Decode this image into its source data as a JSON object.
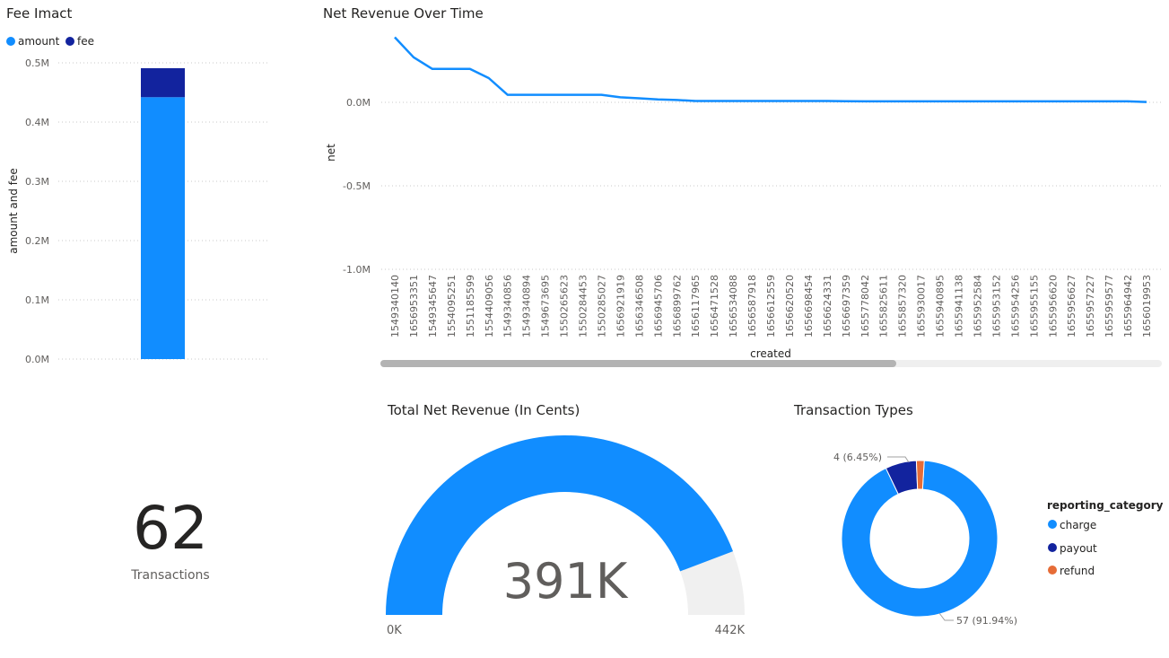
{
  "fee_chart": {
    "title": "Fee Imact",
    "legend": [
      {
        "label": "amount",
        "color": "#118DFF"
      },
      {
        "label": "fee",
        "color": "#12239E"
      }
    ],
    "ylabel": "amount and fee",
    "yticks": [
      "0.0M",
      "0.1M",
      "0.2M",
      "0.3M",
      "0.4M",
      "0.5M"
    ]
  },
  "line_chart": {
    "title": "Net Revenue Over Time",
    "ylabel": "net",
    "xlabel": "created",
    "yticks": [
      "0.0M",
      "-0.5M",
      "-1.0M"
    ]
  },
  "card": {
    "value": "62",
    "label": "Transactions"
  },
  "gauge": {
    "title": "Total Net Revenue (In Cents)",
    "value_label": "391K",
    "min_label": "0K",
    "max_label": "442K"
  },
  "donut": {
    "title": "Transaction Types",
    "legend_title": "reporting_category",
    "legend": [
      {
        "label": "charge",
        "color": "#118DFF"
      },
      {
        "label": "payout",
        "color": "#12239E"
      },
      {
        "label": "refund",
        "color": "#E66C37"
      }
    ],
    "callout_payout": "4 (6.45%)",
    "callout_charge": "57 (91.94%)"
  },
  "chart_data": [
    {
      "type": "bar",
      "title": "Fee Imact",
      "ylabel": "amount and fee",
      "ylim": [
        0,
        0.5
      ],
      "unit": "M",
      "stacked": true,
      "series": [
        {
          "name": "amount",
          "values": [
            0.442
          ],
          "color": "#118DFF"
        },
        {
          "name": "fee",
          "values": [
            0.049
          ],
          "color": "#12239E"
        }
      ],
      "legend": "top-left",
      "grid": true
    },
    {
      "type": "line",
      "title": "Net Revenue Over Time",
      "xlabel": "created",
      "ylabel": "net",
      "ylim": [
        -1.0,
        0.3
      ],
      "unit": "M",
      "x": [
        "1549340140",
        "1656953351",
        "1549345647",
        "1554095251",
        "1551185599",
        "1554409056",
        "1549340856",
        "1549340894",
        "1549673695",
        "1550265623",
        "1550284453",
        "1550285027",
        "1656921919",
        "1656346508",
        "1656945706",
        "1656899762",
        "1656117965",
        "1656471528",
        "1656534088",
        "1656587918",
        "1656612559",
        "1656620520",
        "1656698454",
        "1656624331",
        "1656697359",
        "1655778042",
        "1655825611",
        "1655857320",
        "1655930017",
        "1655940895",
        "1655941138",
        "1655952584",
        "1655953152",
        "1655954256",
        "1655955155",
        "1655956620",
        "1655956627",
        "1655957227",
        "1655959577",
        "1655964942",
        "1656019953"
      ],
      "series": [
        {
          "values": [
            0.39,
            0.27,
            0.2,
            0.2,
            0.2,
            0.145,
            0.045,
            0.045,
            0.045,
            0.045,
            0.045,
            0.045,
            0.03,
            0.024,
            0.018,
            0.014,
            0.008,
            0.008,
            0.008,
            0.008,
            0.008,
            0.008,
            0.008,
            0.008,
            0.007,
            0.006,
            0.006,
            0.006,
            0.006,
            0.006,
            0.006,
            0.006,
            0.006,
            0.006,
            0.006,
            0.006,
            0.006,
            0.006,
            0.006,
            0.006,
            0.002
          ],
          "color": "#118DFF"
        }
      ],
      "grid": true
    },
    {
      "type": "gauge",
      "title": "Total Net Revenue (In Cents)",
      "value": 391,
      "min": 0,
      "max": 442,
      "unit": "K",
      "color": "#118DFF",
      "track_color": "#F0F0F0"
    },
    {
      "type": "pie",
      "title": "Transaction Types",
      "donut": true,
      "labels": [
        "charge",
        "payout",
        "refund"
      ],
      "values": [
        57,
        4,
        1
      ],
      "colors": [
        "#118DFF",
        "#12239E",
        "#E66C37"
      ],
      "legend": "right"
    }
  ]
}
